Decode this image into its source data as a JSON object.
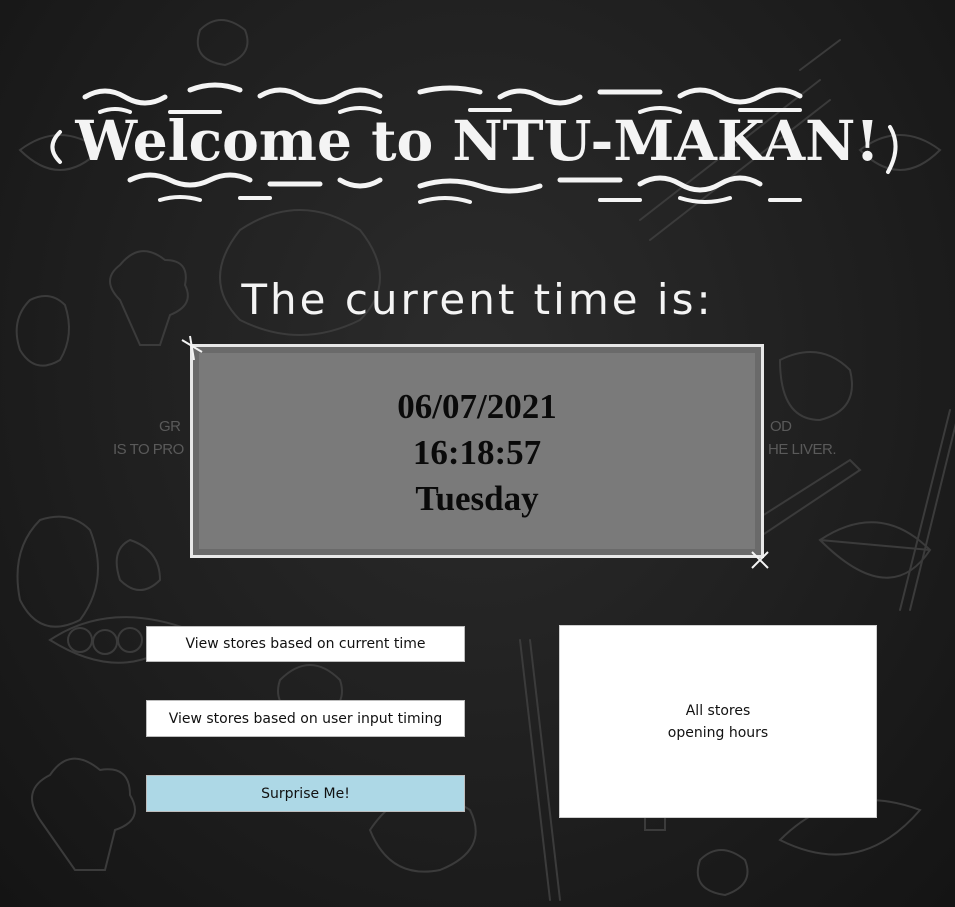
{
  "header": {
    "title": "Welcome to NTU-MAKAN!"
  },
  "clock": {
    "heading": "The current time is:",
    "date": "06/07/2021",
    "time": "16:18:57",
    "day": "Tuesday"
  },
  "actions": {
    "current_time_label": "View stores based on current time",
    "user_input_label": "View stores based on user input timing",
    "surprise_label": "Surprise Me!"
  },
  "hours_panel": {
    "line1": "All stores",
    "line2": "opening hours"
  },
  "background": {
    "partial_text_left_1": "GR",
    "partial_text_left_2": "IS TO PRO",
    "partial_text_right_1": "OD",
    "partial_text_right_2": "HE LIVER."
  },
  "colors": {
    "background": "#1e1e1e",
    "clock_box": "#7a7a7a",
    "accent_button": "#add8e6",
    "chalk": "#f4f4f4"
  }
}
